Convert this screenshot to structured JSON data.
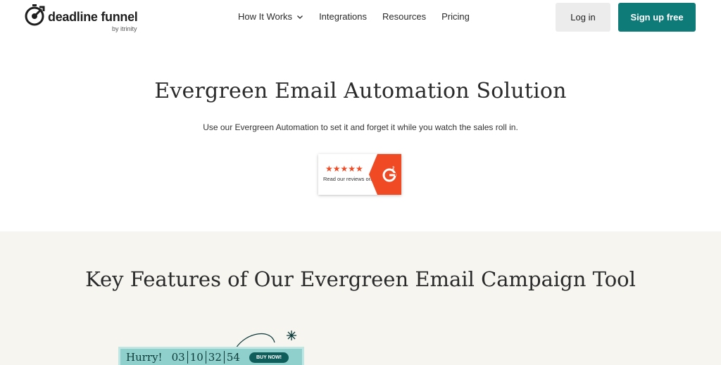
{
  "brand": {
    "name": "deadline funnel",
    "sub": "by itrinity",
    "accent": "#0f7b78"
  },
  "nav": {
    "items": [
      {
        "label": "How It Works",
        "has_dropdown": true
      },
      {
        "label": "Integrations"
      },
      {
        "label": "Resources"
      },
      {
        "label": "Pricing"
      }
    ],
    "login_label": "Log in",
    "signup_label": "Sign up free"
  },
  "hero": {
    "title": "Evergreen Email Automation Solution",
    "subtitle": "Use our Evergreen Automation to set it and forget it while you watch the sales roll in."
  },
  "g2_badge": {
    "stars": "★★★★★",
    "text": "Read our reviews on",
    "color": "#ef4a23"
  },
  "features": {
    "title": "Key Features of Our Evergreen Email Campaign Tool",
    "background": "#f6f5f0"
  },
  "timer": {
    "label": "Hurry!",
    "days": "03",
    "hours": "10",
    "minutes": "32",
    "seconds": "54",
    "button": "BUY NOW!"
  }
}
